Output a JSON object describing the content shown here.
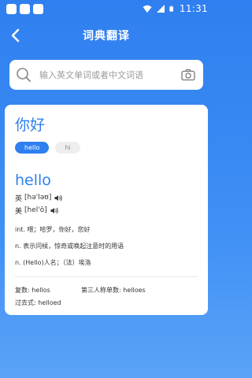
{
  "status_bar": {
    "time": "11:31"
  },
  "header": {
    "title": "词典翻译",
    "back_icon": "chevron-left-icon"
  },
  "search": {
    "placeholder": "输入英文单词或者中文词语",
    "value": "",
    "search_icon": "search-icon",
    "camera_icon": "camera-icon"
  },
  "result": {
    "query": "你好",
    "chips": [
      {
        "label": "hello",
        "active": true
      },
      {
        "label": "hi",
        "active": false
      }
    ],
    "headword": "hello",
    "phonetics": [
      {
        "label": "英",
        "ipa": "[hə'ləʊ]"
      },
      {
        "label": "美",
        "ipa": "[hel'ō]"
      }
    ],
    "definitions": [
      "int. 喂；哈罗，你好，您好",
      "n. 表示问候，惊奇或唤起注意时的用语",
      "n. (Hello)人名；（法）埃洛"
    ],
    "forms": {
      "plural_label": "复数:",
      "plural_value": "hellos",
      "third_person_label": "第三人称单数:",
      "third_person_value": "helloes",
      "past_label": "过去式:",
      "past_value": "helloed"
    }
  },
  "colors": {
    "accent": "#2f7ff0",
    "background_top": "#2f7ff0",
    "background_bottom": "#5aa3f7",
    "card": "#ffffff"
  }
}
